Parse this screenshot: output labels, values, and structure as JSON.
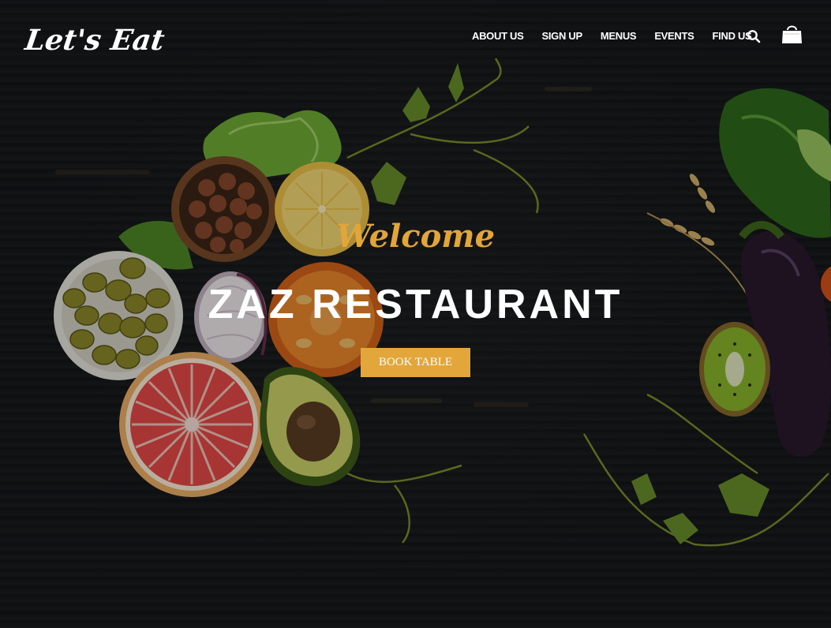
{
  "brand": {
    "logo_text": "Let's Eat"
  },
  "nav": {
    "items": [
      {
        "label": "ABOUT US"
      },
      {
        "label": "SIGN UP"
      },
      {
        "label": "MENUS"
      },
      {
        "label": "EVENTS"
      },
      {
        "label": "FIND US"
      }
    ],
    "icons": [
      "search-icon",
      "shopping-bag-icon"
    ]
  },
  "hero": {
    "welcome": "Welcome",
    "title": "ZAZ RESTAURANT",
    "cta_label": "BOOK TABLE"
  },
  "colors": {
    "accent": "#e3a63b",
    "background": "#141618",
    "text": "#ffffff"
  }
}
